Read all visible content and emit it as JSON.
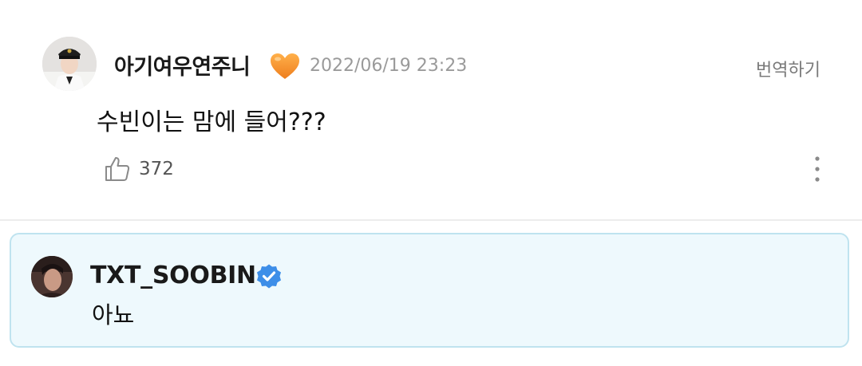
{
  "comment": {
    "username": "아기여우연주니",
    "timestamp": "2022/06/19 23:23",
    "translate_label": "번역하기",
    "text": "수빈이는 맘에 들어???",
    "like_count": "372",
    "heart_color": "#F28A2A"
  },
  "reply": {
    "username": "TXT_SOOBIN",
    "text": "아뇨",
    "verified_color": "#3D8EE8",
    "background_color": "#EEF9FD"
  },
  "icons": [
    "avatar",
    "orange-heart-emoji",
    "thumbs-up-icon",
    "more-vertical-icon",
    "verified-badge-icon"
  ]
}
